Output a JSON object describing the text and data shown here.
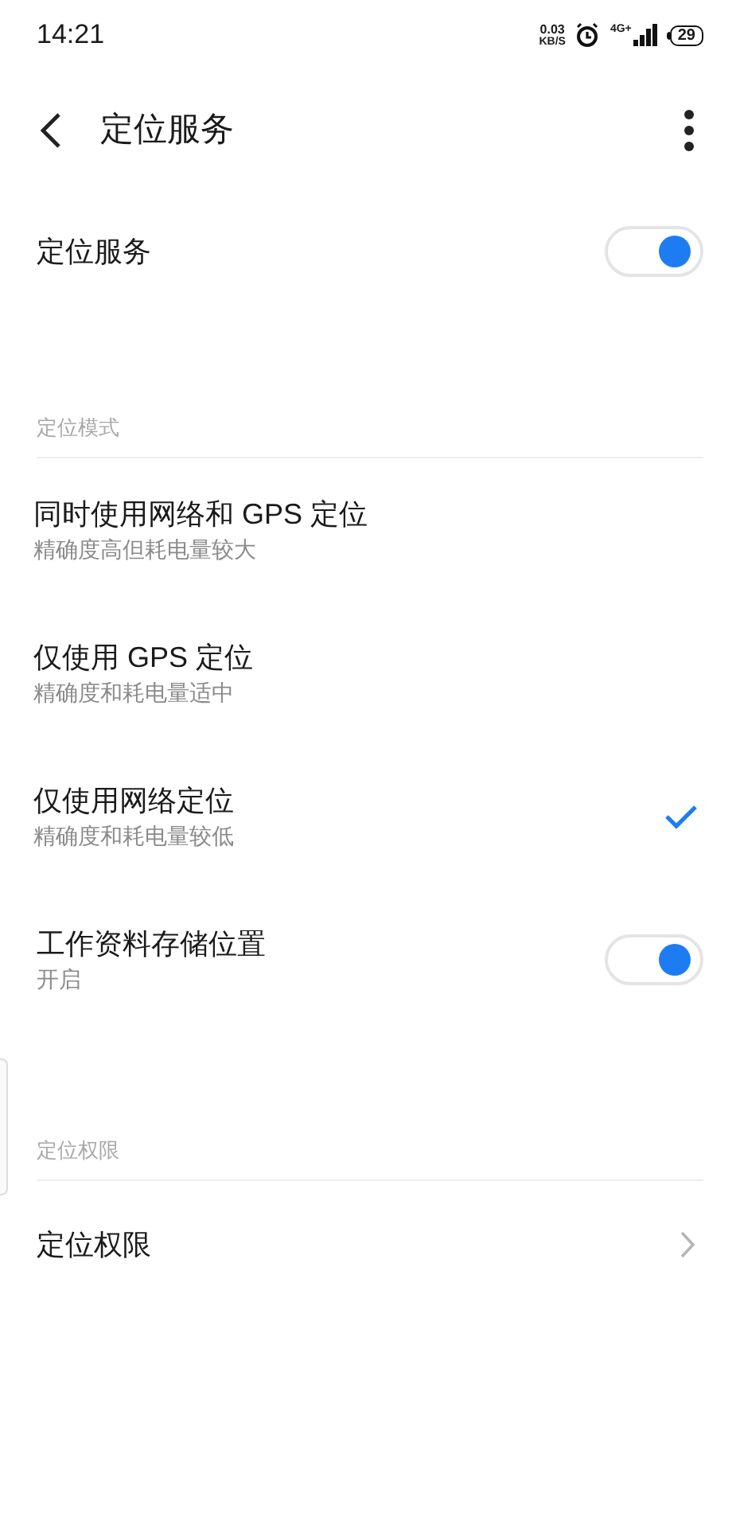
{
  "status_bar": {
    "time": "14:21",
    "net_speed": "0.03",
    "net_speed_unit": "KB/S",
    "network_type": "4G+",
    "battery": "29"
  },
  "header": {
    "title": "定位服务"
  },
  "items": [
    {
      "kind": "toggle",
      "title": "定位服务",
      "on": true
    },
    {
      "kind": "section",
      "title": "定位模式"
    },
    {
      "kind": "radio",
      "title": "同时使用网络和 GPS 定位",
      "subtitle": "精确度高但耗电量较大",
      "selected": false
    },
    {
      "kind": "radio",
      "title": "仅使用 GPS 定位",
      "subtitle": "精确度和耗电量适中",
      "selected": false
    },
    {
      "kind": "radio",
      "title": "仅使用网络定位",
      "subtitle": "精确度和耗电量较低",
      "selected": true
    },
    {
      "kind": "toggle",
      "title": "工作资料存储位置",
      "subtitle": "开启",
      "on": true
    },
    {
      "kind": "section",
      "title": "定位权限"
    },
    {
      "kind": "link",
      "title": "定位权限"
    }
  ]
}
